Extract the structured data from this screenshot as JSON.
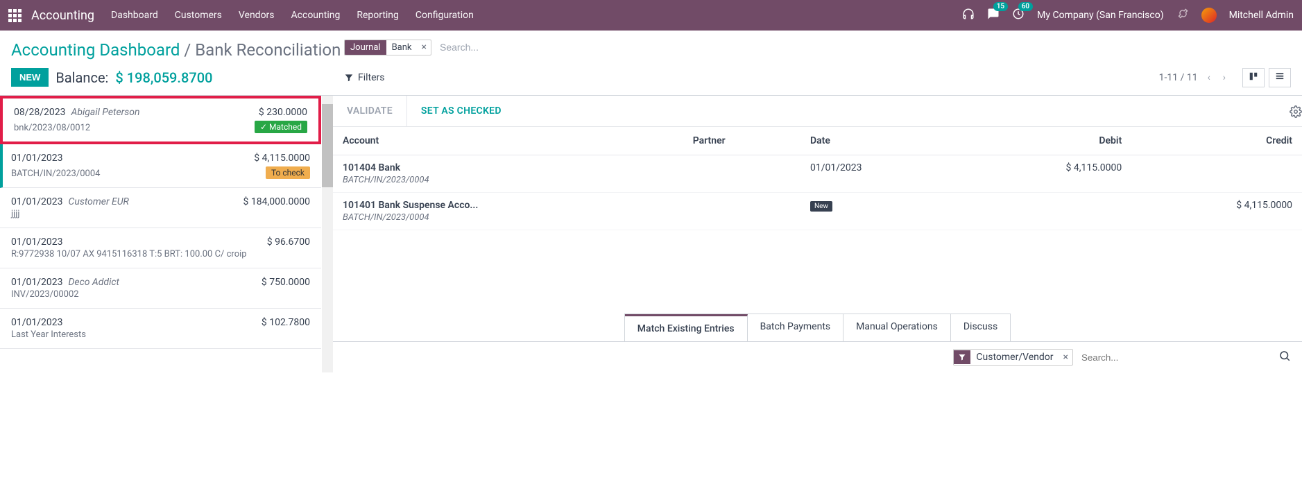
{
  "topnav": {
    "app": "Accounting",
    "items": [
      "Dashboard",
      "Customers",
      "Vendors",
      "Accounting",
      "Reporting",
      "Configuration"
    ],
    "msg_count": "15",
    "activity_count": "60",
    "company": "My Company (San Francisco)",
    "user": "Mitchell Admin"
  },
  "breadcrumb": {
    "root": "Accounting Dashboard",
    "sep": "/",
    "current": "Bank Reconciliation"
  },
  "balance": {
    "new_btn": "NEW",
    "label": "Balance:",
    "currency": "$",
    "value": "198,059.8700"
  },
  "search": {
    "facet_label": "Journal",
    "facet_value": "Bank",
    "placeholder": "Search...",
    "filters_label": "Filters",
    "pager": "1-11 / 11"
  },
  "transactions": [
    {
      "date": "08/28/2023",
      "partner": "Abigail Peterson",
      "amount": "$ 230.0000",
      "ref": "bnk/2023/08/0012",
      "tag": "Matched",
      "tag_class": "tag-matched",
      "highlighted": true
    },
    {
      "date": "01/01/2023",
      "partner": "",
      "amount": "$ 4,115.0000",
      "ref": "BATCH/IN/2023/0004",
      "tag": "To check",
      "tag_class": "tag-tocheck",
      "selected": true
    },
    {
      "date": "01/01/2023",
      "partner": "Customer EUR",
      "amount": "$ 184,000.0000",
      "ref": "jjjj"
    },
    {
      "date": "01/01/2023",
      "partner": "",
      "amount": "$ 96.6700",
      "ref": "R:9772938 10/07 AX 9415116318 T:5 BRT: 100.00 C/ croip"
    },
    {
      "date": "01/01/2023",
      "partner": "Deco Addict",
      "amount": "$ 750.0000",
      "ref": "INV/2023/00002"
    },
    {
      "date": "01/01/2023",
      "partner": "",
      "amount": "$ 102.7800",
      "ref": "Last Year Interests"
    }
  ],
  "detail": {
    "actions": {
      "validate": "VALIDATE",
      "set_checked": "SET AS CHECKED"
    },
    "columns": {
      "account": "Account",
      "partner": "Partner",
      "date": "Date",
      "debit": "Debit",
      "credit": "Credit"
    },
    "rows": [
      {
        "account": "101404 Bank",
        "memo": "BATCH/IN/2023/0004",
        "partner": "",
        "date": "01/01/2023",
        "debit": "$ 4,115.0000",
        "credit": "",
        "badge": ""
      },
      {
        "account": "101401 Bank Suspense Acco...",
        "memo": "BATCH/IN/2023/0004",
        "partner": "",
        "date": "",
        "debit": "",
        "credit": "$ 4,115.0000",
        "badge": "New"
      }
    ]
  },
  "tabs": [
    "Match Existing Entries",
    "Batch Payments",
    "Manual Operations",
    "Discuss"
  ],
  "bottom_search": {
    "facet": "Customer/Vendor",
    "placeholder": "Search..."
  }
}
